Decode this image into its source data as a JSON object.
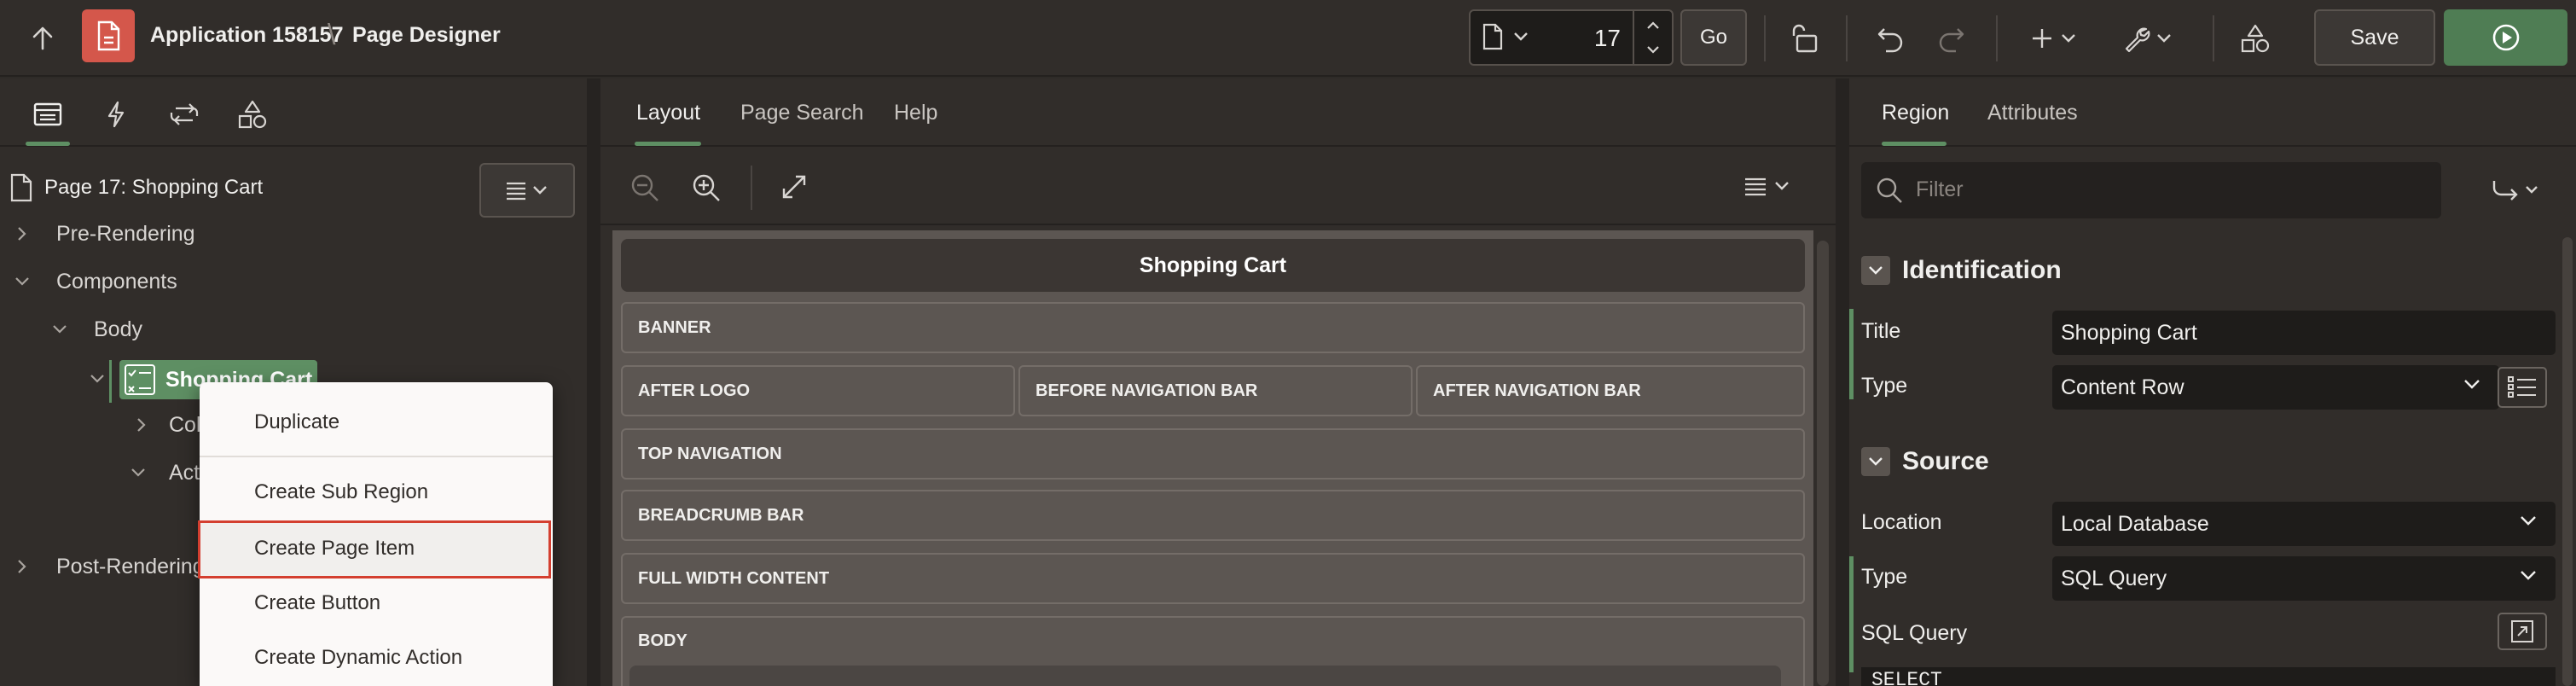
{
  "header": {
    "app_title": "Application 158157",
    "breadcrumb_separator": "\\",
    "page_designer_title": "Page Designer",
    "page_number": "17",
    "go_label": "Go",
    "save_label": "Save"
  },
  "left_panel": {
    "tabs": [
      "rendering",
      "dynamic-actions",
      "processing",
      "shared-components"
    ],
    "tree": {
      "root": "Page 17: Shopping Cart",
      "nodes": {
        "pre_rendering": "Pre-Rendering",
        "components": "Components",
        "body": "Body",
        "shopping_cart": "Shopping Cart",
        "columns_partial": "Col",
        "actions_partial": "Act",
        "post_rendering": "Post-Rendering"
      }
    },
    "context_menu": {
      "items": [
        "Duplicate",
        "Create Sub Region",
        "Create Page Item",
        "Create Button",
        "Create Dynamic Action"
      ],
      "highlighted": "Create Page Item"
    }
  },
  "center_panel": {
    "tabs": [
      "Layout",
      "Page Search",
      "Help"
    ],
    "active_tab": "Layout",
    "canvas": {
      "page_title": "Shopping Cart",
      "positions": {
        "banner": "BANNER",
        "after_logo": "AFTER LOGO",
        "before_nav": "BEFORE NAVIGATION BAR",
        "after_nav": "AFTER NAVIGATION BAR",
        "top_nav": "TOP NAVIGATION",
        "breadcrumb": "BREADCRUMB BAR",
        "full_width": "FULL WIDTH CONTENT",
        "body": "BODY"
      }
    }
  },
  "right_panel": {
    "tabs": [
      "Region",
      "Attributes"
    ],
    "active_tab": "Region",
    "filter_placeholder": "Filter",
    "sections": {
      "identification": {
        "heading": "Identification",
        "title_label": "Title",
        "title_value": "Shopping Cart",
        "type_label": "Type",
        "type_value": "Content Row"
      },
      "source": {
        "heading": "Source",
        "location_label": "Location",
        "location_value": "Local Database",
        "type_label": "Type",
        "type_value": "SQL Query",
        "sql_label": "SQL Query",
        "sql_value": "SELECT"
      }
    }
  },
  "colors": {
    "accent_green": "#5e8f63",
    "app_icon_red": "#d4574b",
    "highlight_red": "#d43f30",
    "background": "#312d2a"
  }
}
